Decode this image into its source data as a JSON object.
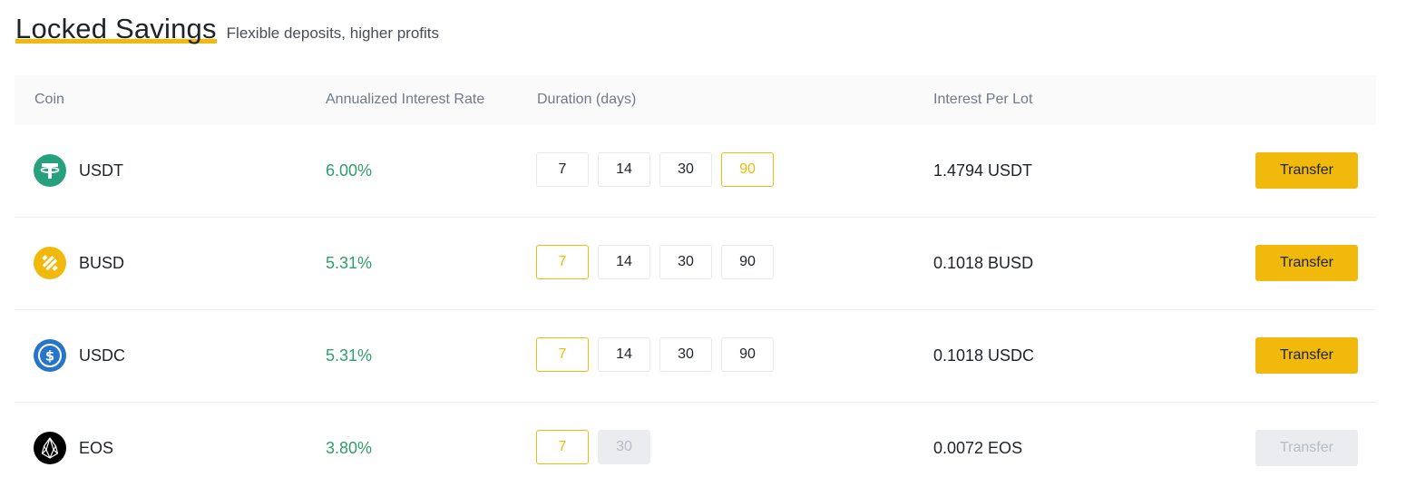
{
  "header": {
    "title": "Locked Savings",
    "subtitle": "Flexible deposits, higher profits"
  },
  "table": {
    "columns": {
      "coin": "Coin",
      "rate": "Annualized Interest Rate",
      "duration": "Duration (days)",
      "interest": "Interest Per Lot"
    },
    "rows": [
      {
        "coin": "USDT",
        "icon": "tether-icon",
        "rate": "6.00%",
        "durations": [
          "7",
          "14",
          "30",
          "90"
        ],
        "selected_duration": "90",
        "interest": "1.4794 USDT",
        "action": "Transfer"
      },
      {
        "coin": "BUSD",
        "icon": "busd-icon",
        "rate": "5.31%",
        "durations": [
          "7",
          "14",
          "30",
          "90"
        ],
        "selected_duration": "7",
        "interest": "0.1018 BUSD",
        "action": "Transfer"
      },
      {
        "coin": "USDC",
        "icon": "usdc-icon",
        "rate": "5.31%",
        "durations": [
          "7",
          "14",
          "30",
          "90"
        ],
        "selected_duration": "7",
        "interest": "0.1018 USDC",
        "action": "Transfer"
      },
      {
        "coin": "EOS",
        "icon": "eos-icon",
        "rate": "3.80%",
        "durations": [
          "7",
          "30"
        ],
        "selected_duration": "7",
        "disabled_durations": [
          "30"
        ],
        "interest": "0.0072 EOS",
        "action": "Transfer",
        "action_disabled": true
      }
    ]
  },
  "colors": {
    "accent": "#f0b90b",
    "rate_green": "#2f9e6b",
    "tether": "#26a17b",
    "busd": "#f0b90b",
    "usdc": "#2775ca",
    "eos": "#000000",
    "disabled_bg": "#eaecef",
    "disabled_text": "#b7bdc6"
  }
}
